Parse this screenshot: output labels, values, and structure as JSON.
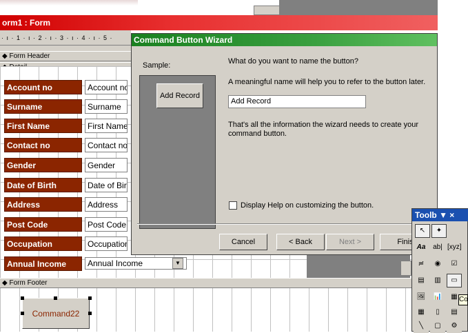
{
  "form": {
    "title": "orm1 : Form",
    "ruler": "· ı · 1 · ı · 2 · ı · 3 · ı · 4 · ı · 5 ·",
    "sections": {
      "header": "Form Header",
      "detail": "Detail",
      "footer": "Form Footer"
    },
    "fields": [
      {
        "label": "Account no",
        "value": "Account no"
      },
      {
        "label": "Surname",
        "value": "Surname"
      },
      {
        "label": "First Name",
        "value": "First Name"
      },
      {
        "label": "Contact no",
        "value": "Contact no"
      },
      {
        "label": "Gender",
        "value": "Gender"
      },
      {
        "label": "Date of Birth",
        "value": "Date of Birth"
      },
      {
        "label": "Address",
        "value": "Address"
      },
      {
        "label": "Post Code",
        "value": "Post Code"
      },
      {
        "label": "Occupation",
        "value": "Occupation"
      },
      {
        "label": "Annual Income",
        "value": "Annual Income"
      }
    ],
    "footer_button": "Command22"
  },
  "wizard": {
    "title": "Command Button Wizard",
    "sample_label": "Sample:",
    "sample_button": "Add Record",
    "question": "What do you want to name the button?",
    "hint": "A meaningful name will help you to refer to the button later.",
    "name_value": "Add Record",
    "info": "That's all the information the wizard needs to create your command button.",
    "help_checkbox": "Display Help on customizing the button.",
    "buttons": {
      "cancel": "Cancel",
      "back": "< Back",
      "next": "Next >",
      "finish": "Finish"
    }
  },
  "toolbox": {
    "title": "Toolb ▼ ×",
    "tools": [
      "↖",
      "✦",
      "Aa",
      "ab|",
      "[xyz]",
      "≓",
      "◉",
      "☑",
      "▤",
      "▥",
      "▭",
      "🖼",
      "📊",
      "▦",
      "▦",
      "▯",
      "▤",
      "╲",
      "▢",
      "⚙"
    ]
  },
  "tooltip": "Co"
}
